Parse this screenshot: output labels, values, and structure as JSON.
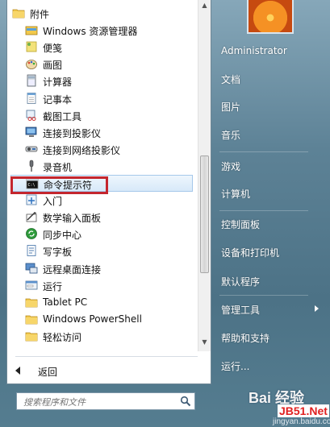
{
  "programs": [
    {
      "label": "附件",
      "icon": "folder-icon",
      "indent": 0
    },
    {
      "label": "Windows 资源管理器",
      "icon": "explorer-icon",
      "indent": 1
    },
    {
      "label": "便笺",
      "icon": "sticky-notes-icon",
      "indent": 1
    },
    {
      "label": "画图",
      "icon": "paint-icon",
      "indent": 1
    },
    {
      "label": "计算器",
      "icon": "calculator-icon",
      "indent": 1
    },
    {
      "label": "记事本",
      "icon": "notepad-icon",
      "indent": 1
    },
    {
      "label": "截图工具",
      "icon": "snipping-tool-icon",
      "indent": 1
    },
    {
      "label": "连接到投影仪",
      "icon": "projector-icon",
      "indent": 1
    },
    {
      "label": "连接到网络投影仪",
      "icon": "network-projector-icon",
      "indent": 1
    },
    {
      "label": "录音机",
      "icon": "microphone-icon",
      "indent": 1
    },
    {
      "label": "命令提示符",
      "icon": "command-prompt-icon",
      "indent": 1,
      "selected": true
    },
    {
      "label": "入门",
      "icon": "getting-started-icon",
      "indent": 1
    },
    {
      "label": "数学输入面板",
      "icon": "math-input-icon",
      "indent": 1
    },
    {
      "label": "同步中心",
      "icon": "sync-center-icon",
      "indent": 1
    },
    {
      "label": "写字板",
      "icon": "wordpad-icon",
      "indent": 1
    },
    {
      "label": "远程桌面连接",
      "icon": "remote-desktop-icon",
      "indent": 1
    },
    {
      "label": "运行",
      "icon": "run-icon",
      "indent": 1
    },
    {
      "label": "Tablet PC",
      "icon": "folder-icon",
      "indent": 1
    },
    {
      "label": "Windows PowerShell",
      "icon": "folder-icon",
      "indent": 1
    },
    {
      "label": "轻松访问",
      "icon": "folder-icon",
      "indent": 1
    }
  ],
  "back_label": "返回",
  "search_placeholder": "搜索程序和文件",
  "right_menu": [
    {
      "label": "Administrator"
    },
    {
      "label": "文档"
    },
    {
      "label": "图片"
    },
    {
      "label": "音乐"
    },
    {
      "label": "游戏"
    },
    {
      "label": "计算机"
    },
    {
      "label": "控制面板"
    },
    {
      "label": "设备和打印机"
    },
    {
      "label": "默认程序"
    },
    {
      "label": "管理工具",
      "submenu": true
    },
    {
      "label": "帮助和支持"
    },
    {
      "label": "运行..."
    }
  ],
  "watermark": {
    "main": "Bai 经验",
    "brand": "JB51.Net",
    "url": "jingyan.baidu.com"
  },
  "colors": {
    "highlight_border": "#c4262e",
    "selection_fill": "#d7e9f9"
  }
}
